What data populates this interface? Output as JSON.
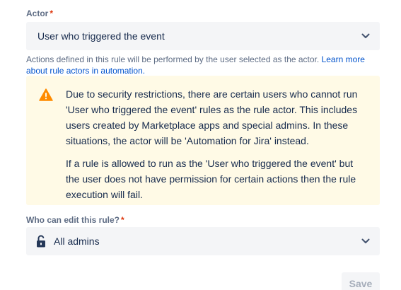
{
  "actor": {
    "label": "Actor",
    "required_mark": "*",
    "selected": "User who triggered the event",
    "helper_text": "Actions defined in this rule will be performed by the user selected as the actor. ",
    "helper_link": "Learn more about rule actors in automation."
  },
  "warning": {
    "icon": "warning-icon",
    "paragraph1": "Due to security restrictions, there are certain users who cannot run 'User who triggered the event' rules as the rule actor. This includes users created by Marketplace apps and special admins. In these situations, the actor will be 'Automation for Jira' instead.",
    "paragraph2": "If a rule is allowed to run as the 'User who triggered the event' but the user does not have permission for certain actions then the rule execution will fail."
  },
  "editors": {
    "label": "Who can edit this rule?",
    "required_mark": "*",
    "icon": "unlock-icon",
    "selected": "All admins"
  },
  "footer": {
    "save_label": "Save"
  },
  "colors": {
    "required": "#de350b",
    "link": "#0052cc",
    "warning_bg": "#fffae6",
    "warning_icon": "#ff8b00",
    "select_bg": "#f4f5f7"
  }
}
